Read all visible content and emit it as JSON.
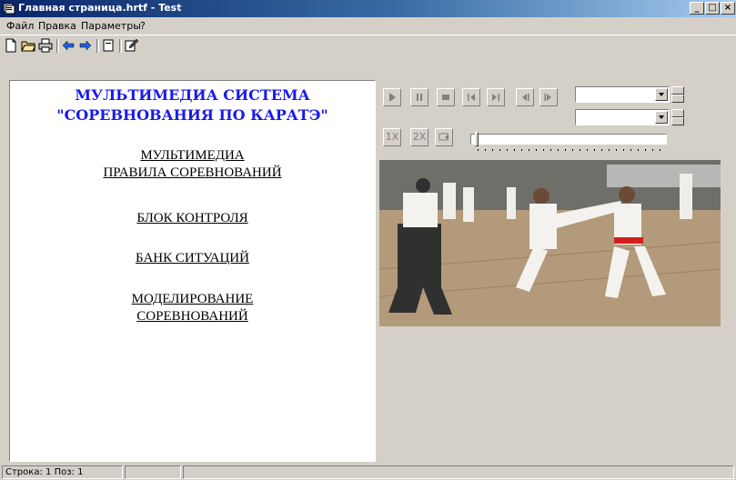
{
  "window": {
    "title": "Главная страница.hrtf - Test",
    "minimize_label": "_",
    "maximize_label": "□",
    "close_label": "×"
  },
  "menu": [
    "Файл",
    "Правка",
    "Параметры",
    "?"
  ],
  "toolbar": {
    "buttons": [
      "new-document-icon",
      "open-folder-icon",
      "print-icon",
      "back-arrow-icon",
      "forward-arrow-icon",
      "page-icon",
      "edit-icon"
    ]
  },
  "document": {
    "heading_line1": "МУЛЬТИМЕДИА СИСТЕМА",
    "heading_line2": "\"СОРЕВНОВАНИЯ ПО КАРАТЭ\"",
    "links": [
      {
        "lines": [
          "МУЛЬТИМЕДИА",
          "ПРАВИЛА СОРЕВНОВАНИЙ"
        ]
      },
      {
        "lines": [
          "БЛОК КОНТРОЛЯ"
        ]
      },
      {
        "lines": [
          "БАНК СИТУАЦИЙ"
        ]
      },
      {
        "lines": [
          "МОДЕЛИРОВАНИЕ",
          "СОРЕВНОВАНИЙ"
        ]
      }
    ],
    "heading_color": "#1a1ae8"
  },
  "player": {
    "controls": [
      "play-icon",
      "pause-icon",
      "stop-icon",
      "skip-start-icon",
      "skip-end-icon",
      "step-back-icon",
      "step-forward-icon"
    ],
    "speed_1x": "1X",
    "speed_2x": "2X",
    "combo1_value": "",
    "combo2_value": "",
    "position": 0.02
  },
  "status": {
    "row_label": "Строка:",
    "row_value": "1",
    "pos_label": "Поз:",
    "pos_value": "1"
  }
}
